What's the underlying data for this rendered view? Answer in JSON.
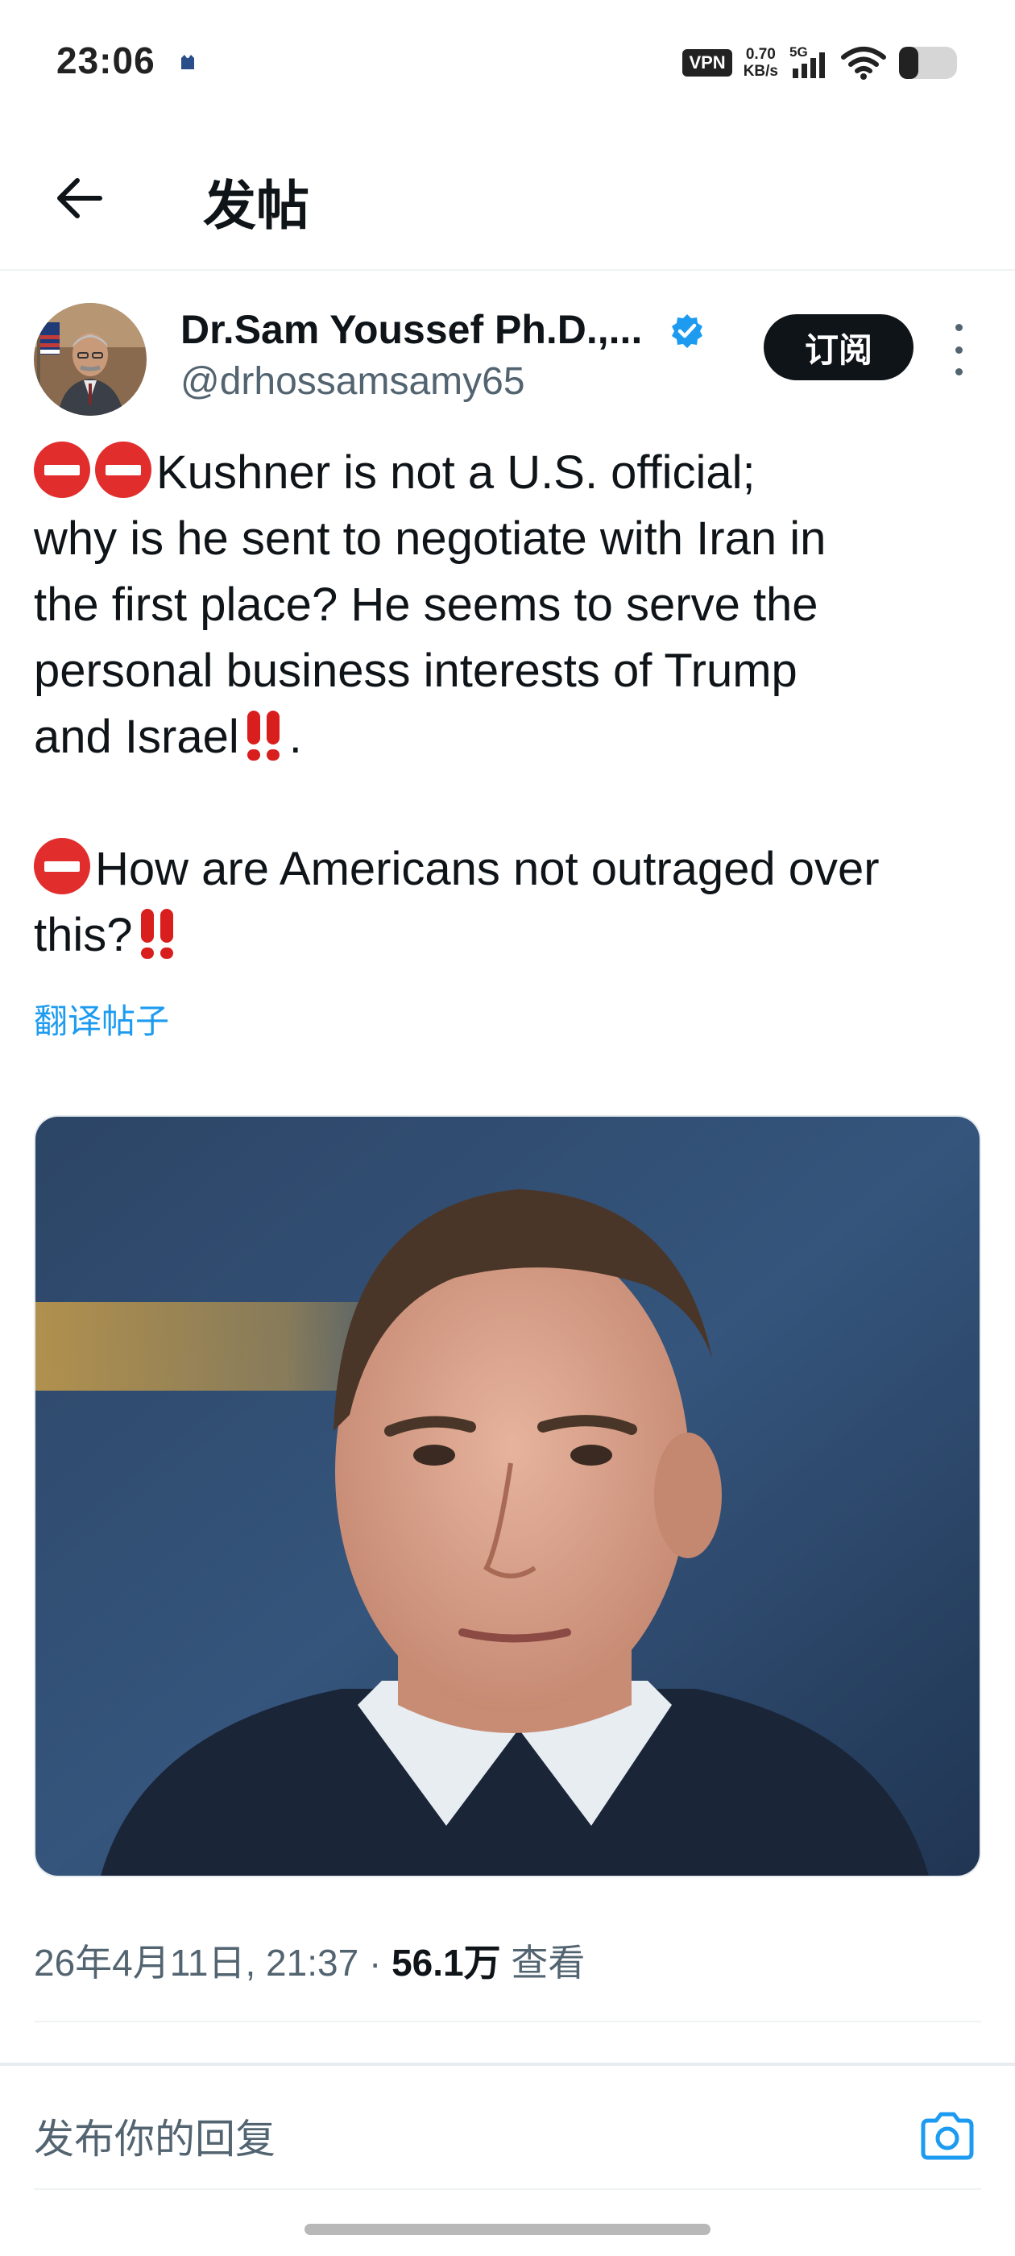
{
  "status_bar": {
    "time": "23:06",
    "vpn": "VPN",
    "speed_value": "0.70",
    "speed_unit": "KB/s",
    "network": "5G",
    "battery_level": 0.3
  },
  "header": {
    "title": "发帖"
  },
  "author": {
    "name": "Dr.Sam Youssef Ph.D.,...",
    "handle": "@drhossamsamy65",
    "subscribe_label": "订阅",
    "verified": true
  },
  "tweet": {
    "line1": "Kushner is not a U.S. official;",
    "line2": "why is he sent to negotiate with Iran in",
    "line3": "the first place? He seems to serve the",
    "line4": "personal business interests of Trump",
    "line5": "and Israel",
    "line5_end": ".",
    "para2": "How are Americans not outraged over",
    "para2_cont": "this?",
    "translate": "翻译帖子"
  },
  "meta": {
    "datetime": "26年4月11日, 21:37 · ",
    "views": "56.1万",
    "views_label": " 查看"
  },
  "reply": {
    "placeholder": "发布你的回复"
  },
  "colors": {
    "accent": "#1d9bf0",
    "text": "#0f1419",
    "secondary": "#536471",
    "emoji_red": "#e22d2d"
  }
}
